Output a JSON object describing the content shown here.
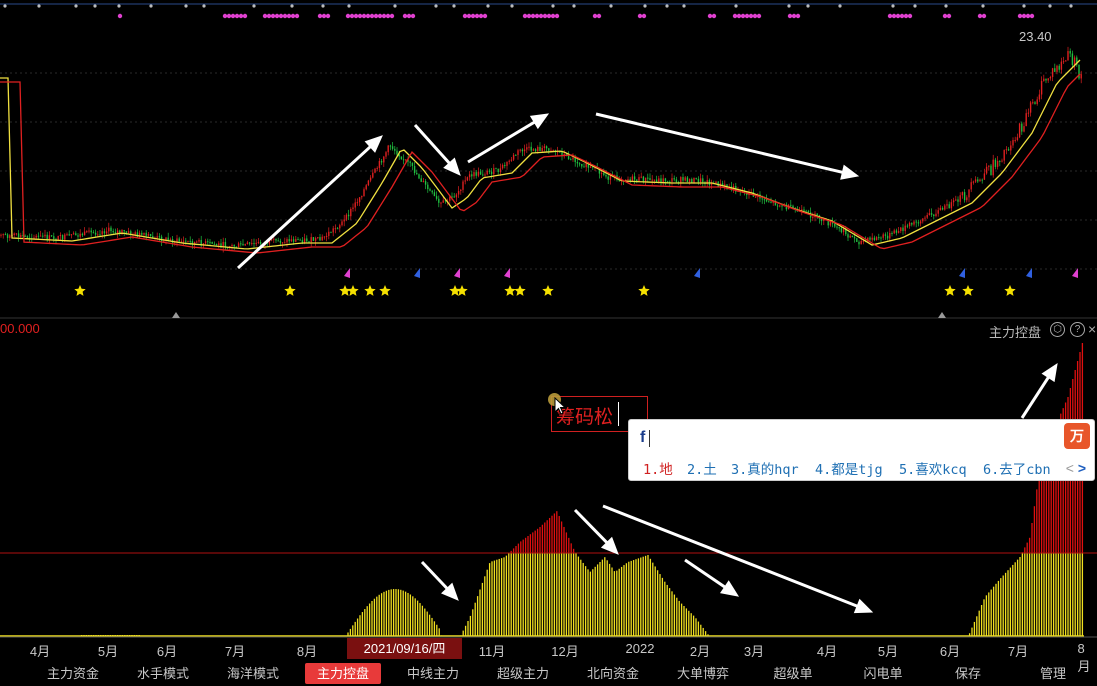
{
  "upper_chart": {
    "price_high_label": "23.40",
    "colors": {
      "up": "#e02020",
      "down": "#20c040",
      "ma_fast": "#f0e040",
      "ma_slow": "#e02020",
      "star": "#f5e000",
      "marker_magenta": "#e040d0",
      "marker_blue": "#3060e0"
    }
  },
  "indicator": {
    "value_label": "00.000",
    "name": "主力控盘",
    "settings_icon": "settings-icon",
    "help_icon": "help-icon",
    "close_icon": "close-icon",
    "colors": {
      "bar_yellow": "#f0e020",
      "bar_red": "#e01010",
      "threshold_line": "#b01010"
    }
  },
  "edit_box": {
    "text": "筹码松"
  },
  "ime": {
    "input": "f",
    "logo": "万",
    "candidates": [
      {
        "label": "1.地"
      },
      {
        "label": "2.土"
      },
      {
        "label": "3.真的hqr"
      },
      {
        "label": "4.都是tjg"
      },
      {
        "label": "5.喜欢kcq"
      },
      {
        "label": "6.去了cbn"
      }
    ],
    "prev": "<",
    "next": ">"
  },
  "x_axis": {
    "ticks": [
      "4月",
      "5月",
      "6月",
      "7月",
      "8月",
      "11月",
      "12月",
      "2022",
      "2月",
      "3月",
      "4月",
      "5月",
      "6月",
      "7月",
      "8月"
    ],
    "cursor_date": "2021/09/16/四"
  },
  "tabs": [
    {
      "label": "主力资金",
      "active": false
    },
    {
      "label": "水手模式",
      "active": false
    },
    {
      "label": "海洋模式",
      "active": false
    },
    {
      "label": "主力控盘",
      "active": true
    },
    {
      "label": "中线主力",
      "active": false
    },
    {
      "label": "超级主力",
      "active": false
    },
    {
      "label": "北向资金",
      "active": false
    },
    {
      "label": "大单博弈",
      "active": false
    },
    {
      "label": "超级单",
      "active": false
    },
    {
      "label": "闪电单",
      "active": false
    },
    {
      "label": "保存",
      "active": false
    },
    {
      "label": "管理",
      "active": false
    }
  ]
}
